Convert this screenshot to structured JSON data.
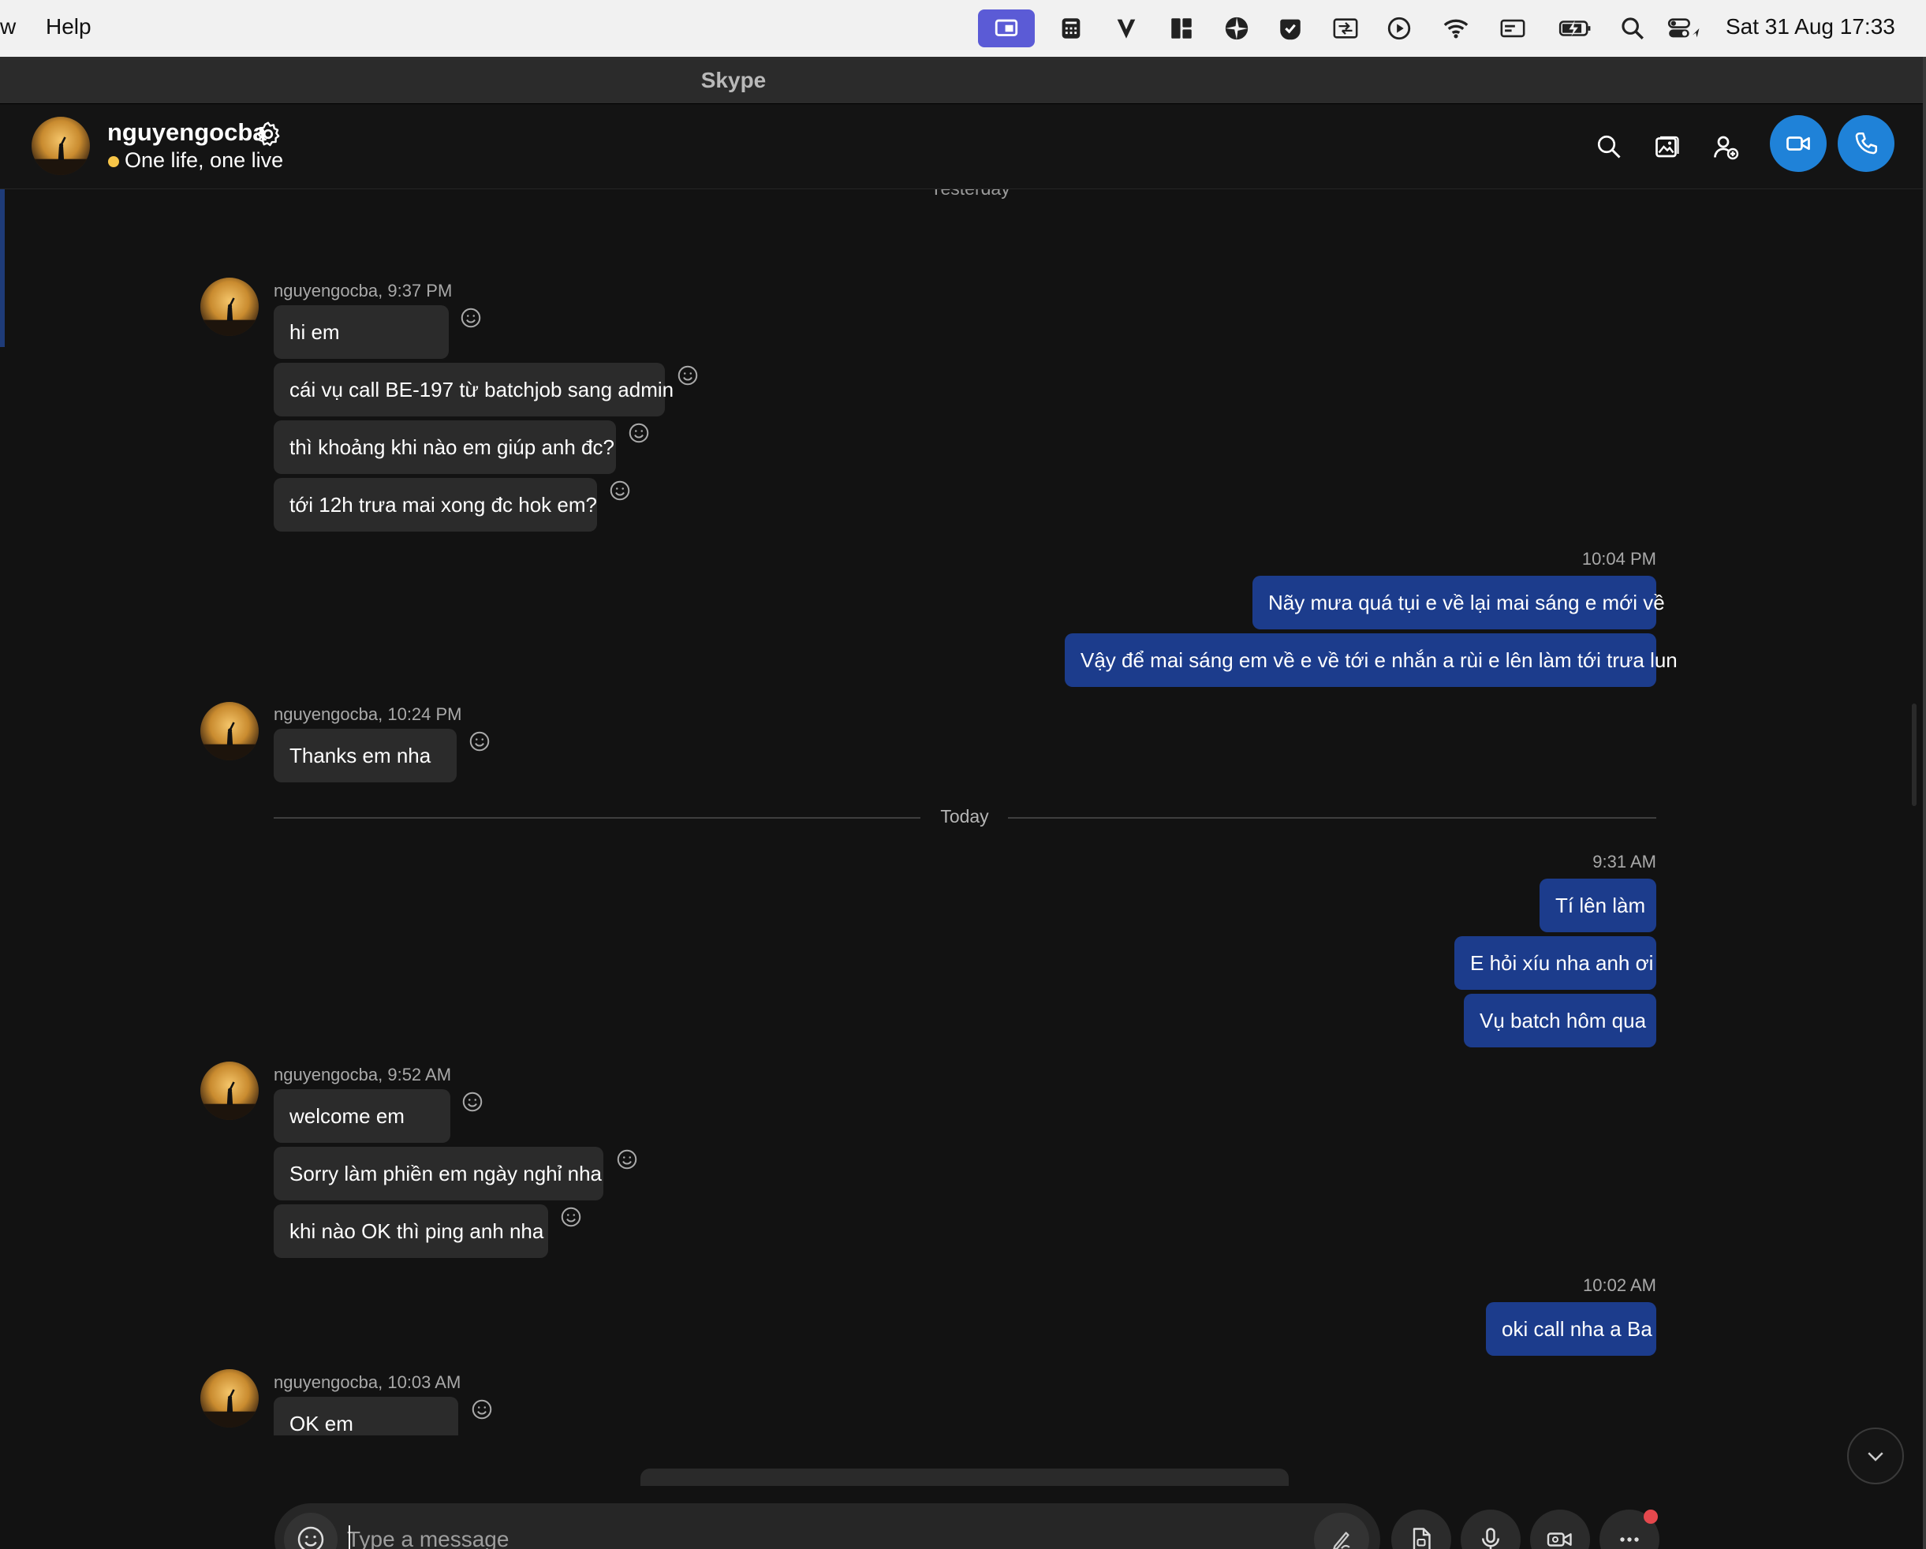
{
  "menubar": {
    "partial_item": "w",
    "help": "Help",
    "clock": "Sat 31 Aug  17:33",
    "status_icons": [
      "screen-share-icon",
      "calculator-icon",
      "v-app-icon",
      "grid-app-icon",
      "aperture-icon",
      "checkmark-app-icon",
      "keyboard-switch-icon",
      "play-circle-icon",
      "wifi-icon",
      "display-icon",
      "battery-charging-icon",
      "spotlight-search-icon",
      "control-center-icon"
    ]
  },
  "window": {
    "title": "Skype"
  },
  "chat_header": {
    "name": "nguyengocba",
    "status": "One life, one live",
    "presence_color": "#f7c548"
  },
  "colors": {
    "incoming_bubble": "#2b2b2b",
    "outgoing_bubble": "#1c3c8c",
    "call_button": "#1f82d8"
  },
  "messages": {
    "yesterday_label": "Yesterday",
    "today_label": "Today",
    "groups": [
      {
        "direction": "in",
        "meta": "nguyengocba, 9:37 PM",
        "bubbles": [
          "hi em",
          "cái vụ call BE-197 từ batchjob sang admin",
          "thì khoảng khi nào em giúp anh đc?",
          "tới 12h trưa mai xong đc hok em?"
        ]
      },
      {
        "direction": "out",
        "meta": "10:04 PM",
        "bubbles": [
          "Nãy mưa quá tụi e về lại mai sáng e mới về",
          "Vậy để mai sáng em về e về tới e nhắn a rùi e lên làm tới trưa lun"
        ]
      },
      {
        "direction": "in",
        "meta": "nguyengocba, 10:24 PM",
        "bubbles": [
          "Thanks em nha"
        ]
      },
      {
        "direction": "out",
        "meta": "9:31 AM",
        "bubbles": [
          "Tí lên làm",
          "E hỏi xíu nha anh ơi",
          "Vụ batch hôm qua"
        ]
      },
      {
        "direction": "in",
        "meta": "nguyengocba, 9:52 AM",
        "bubbles": [
          "welcome em",
          "Sorry làm phiền em ngày nghỉ nha",
          "khi nào OK thì ping anh nha"
        ]
      },
      {
        "direction": "out",
        "meta": "10:02 AM",
        "bubbles": [
          "oki call nha a Ba"
        ]
      },
      {
        "direction": "in",
        "meta": "nguyengocba, 10:03 AM",
        "bubbles": [
          "OK em"
        ]
      }
    ]
  },
  "composer": {
    "placeholder": "Type a message",
    "value": ""
  }
}
